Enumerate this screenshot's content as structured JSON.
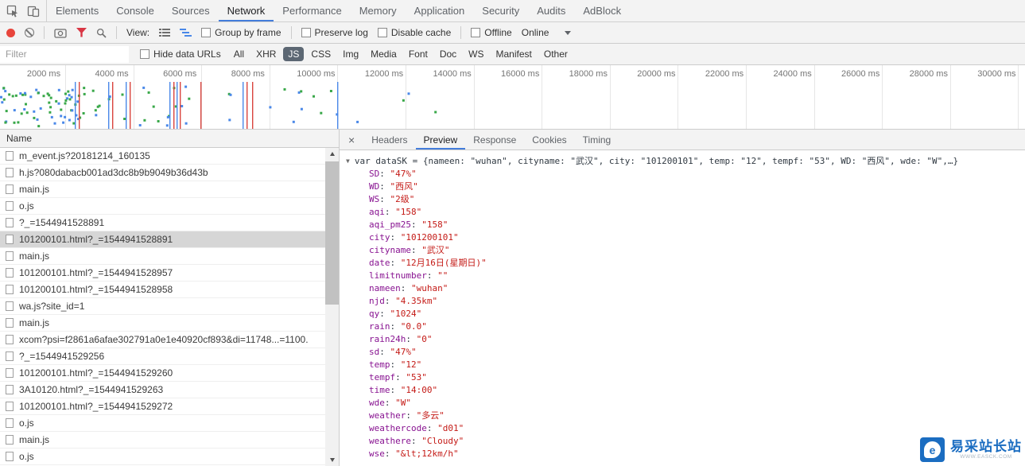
{
  "colors": {
    "accent_blue": "#437ddb",
    "record_red": "#e8453c",
    "filter_funnel_red": "#d93644",
    "active_filter_pill_bg": "#5c6773",
    "selected_row_bg": "#d6d6d6",
    "preview_key": "#881391",
    "preview_string": "#c41a16",
    "waterfall_green": "#39a849",
    "waterfall_blue": "#4a88e8"
  },
  "icons": {
    "expand": "▼"
  },
  "panel_tabs": {
    "items": [
      "Elements",
      "Console",
      "Sources",
      "Network",
      "Performance",
      "Memory",
      "Application",
      "Security",
      "Audits",
      "AdBlock"
    ],
    "active": "Network"
  },
  "toolbar": {
    "view_label": "View:",
    "group_by_frame": "Group by frame",
    "preserve_log": "Preserve log",
    "disable_cache": "Disable cache",
    "offline": "Offline",
    "online": "Online"
  },
  "filter_bar": {
    "placeholder": "Filter",
    "hide_data_urls": "Hide data URLs",
    "types": [
      "All",
      "XHR",
      "JS",
      "CSS",
      "Img",
      "Media",
      "Font",
      "Doc",
      "WS",
      "Manifest",
      "Other"
    ],
    "active_type": "JS"
  },
  "overview": {
    "ticks": [
      "2000 ms",
      "4000 ms",
      "6000 ms",
      "8000 ms",
      "10000 ms",
      "12000 ms",
      "14000 ms",
      "16000 ms",
      "18000 ms",
      "20000 ms",
      "22000 ms",
      "24000 ms",
      "26000 ms",
      "28000 ms",
      "30000 ms"
    ]
  },
  "request_list": {
    "header": "Name",
    "selected_index": 5,
    "items": [
      "m_event.js?20181214_160135",
      "h.js?080dabacb001ad3dc8b9b9049b36d43b",
      "main.js",
      "o.js",
      "?_=1544941528891",
      "101200101.html?_=1544941528891",
      "main.js",
      "101200101.html?_=1544941528957",
      "101200101.html?_=1544941528958",
      "wa.js?site_id=1",
      "main.js",
      "xcom?psi=f2861a6afae302791a0e1e40920cf893&di=11748...=1100.",
      "?_=1544941529256",
      "101200101.html?_=1544941529260",
      "3A10120.html?_=1544941529263",
      "101200101.html?_=1544941529272",
      "o.js",
      "main.js",
      "o.js"
    ]
  },
  "details": {
    "close_label": "×",
    "tabs": [
      "Headers",
      "Preview",
      "Response",
      "Cookies",
      "Timing"
    ],
    "active": "Preview"
  },
  "preview": {
    "root": "var dataSK = {nameen: \"wuhan\", cityname: \"武汉\", city: \"101200101\", temp: \"12\", tempf: \"53\", WD: \"西风\", wde: \"W\",…}",
    "properties": [
      {
        "key": "SD",
        "value": "47%"
      },
      {
        "key": "WD",
        "value": "西风"
      },
      {
        "key": "WS",
        "value": "2级"
      },
      {
        "key": "aqi",
        "value": "158"
      },
      {
        "key": "aqi_pm25",
        "value": "158"
      },
      {
        "key": "city",
        "value": "101200101"
      },
      {
        "key": "cityname",
        "value": "武汉"
      },
      {
        "key": "date",
        "value": "12月16日(星期日)"
      },
      {
        "key": "limitnumber",
        "value": ""
      },
      {
        "key": "nameen",
        "value": "wuhan"
      },
      {
        "key": "njd",
        "value": "4.35km"
      },
      {
        "key": "qy",
        "value": "1024"
      },
      {
        "key": "rain",
        "value": "0.0"
      },
      {
        "key": "rain24h",
        "value": "0"
      },
      {
        "key": "sd",
        "value": "47%"
      },
      {
        "key": "temp",
        "value": "12"
      },
      {
        "key": "tempf",
        "value": "53"
      },
      {
        "key": "time",
        "value": "14:00"
      },
      {
        "key": "wde",
        "value": "W"
      },
      {
        "key": "weather",
        "value": "多云"
      },
      {
        "key": "weathercode",
        "value": "d01"
      },
      {
        "key": "weathere",
        "value": "Cloudy"
      },
      {
        "key": "wse",
        "value": "&lt;12km/h"
      }
    ]
  },
  "watermark": {
    "logo_letter": "e",
    "title": "易采站长站",
    "subtext": "WWW.EASCK.COM"
  }
}
